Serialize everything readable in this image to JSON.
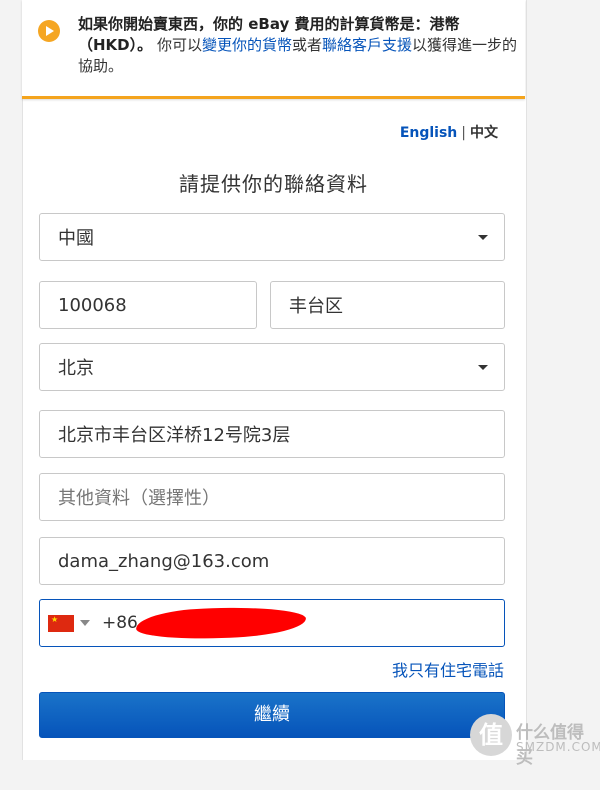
{
  "notice": {
    "line1": "如果你開始賣東西，你的 eBay 費用的計算貨幣是：",
    "currency": "港幣（HKD）",
    "sep": "。",
    "text_a": "你可以",
    "change_link": "變更你的貨幣",
    "text_b": "或者",
    "contact_link": "聯絡客戶支援",
    "text_c": "以獲得進一步的協助。",
    "icon": "play-arrow-icon",
    "accent": "#f5a623"
  },
  "lang": {
    "english": "English",
    "separator": "|",
    "chinese": "中文"
  },
  "heading": "請提供你的聯絡資料",
  "form": {
    "country": "中國",
    "postal": "100068",
    "city": "丰台区",
    "province": "北京",
    "address1": "北京市丰台区洋桥12号院3层",
    "address2_placeholder": "其他資料（選擇性）",
    "email": "dama_zhang@163.com",
    "phone_code": "+86",
    "flag": "china-flag-icon"
  },
  "home_phone_link": "我只有住宅電話",
  "continue_label": "繼續",
  "watermark": {
    "logo": "值",
    "cn": "什么值得买",
    "en": "SMZDM.COM"
  },
  "colors": {
    "link": "#0654ba",
    "button": "#0654ba",
    "notice_border": "#f4a41d"
  }
}
